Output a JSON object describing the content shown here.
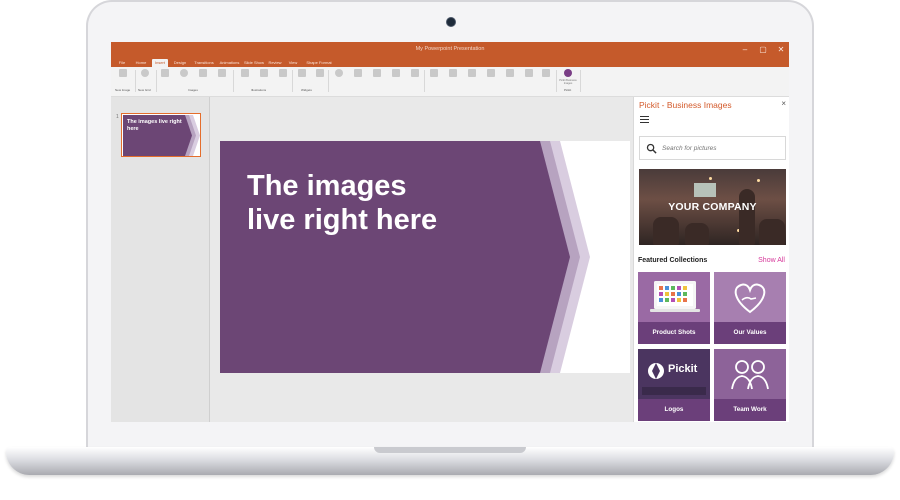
{
  "window": {
    "title": "My Powerpoint Presentation",
    "minimize": "–",
    "maximize": "▢",
    "close": "✕"
  },
  "ribbon": {
    "tabs": [
      "File",
      "Home",
      "Insert",
      "Design",
      "Transitions",
      "Animations",
      "Slide Show",
      "Review",
      "View",
      "Shape Format"
    ],
    "active_tab": "Insert",
    "groups": [
      "New Image",
      "New Grid",
      "Images",
      "Illustrations",
      "Widgets"
    ],
    "plugin_button": "Pickit Business Images",
    "plugin_group": "Pickit"
  },
  "thumbnails": {
    "slide_number": "1",
    "slide_title": "The images live right here"
  },
  "slide": {
    "title": "The images\nlive right here",
    "accent": "#6c4675"
  },
  "pickit": {
    "pane_title": "Pickit - Business Images",
    "close": "×",
    "search_placeholder": "Search for pictures",
    "hero_caption": "YOUR COMPANY",
    "featured_header": "Featured Collections",
    "show_all": "Show All",
    "collections": [
      {
        "label": "Product Shots",
        "icon": "devices-icon"
      },
      {
        "label": "Our Values",
        "icon": "heart-hand-icon"
      },
      {
        "label": "Logos",
        "icon": "pickit-logo-icon",
        "logo_text": "Pickit"
      },
      {
        "label": "Team Work",
        "icon": "people-icon"
      }
    ],
    "brand_color": "#d35a2b",
    "link_color": "#d6389a"
  }
}
